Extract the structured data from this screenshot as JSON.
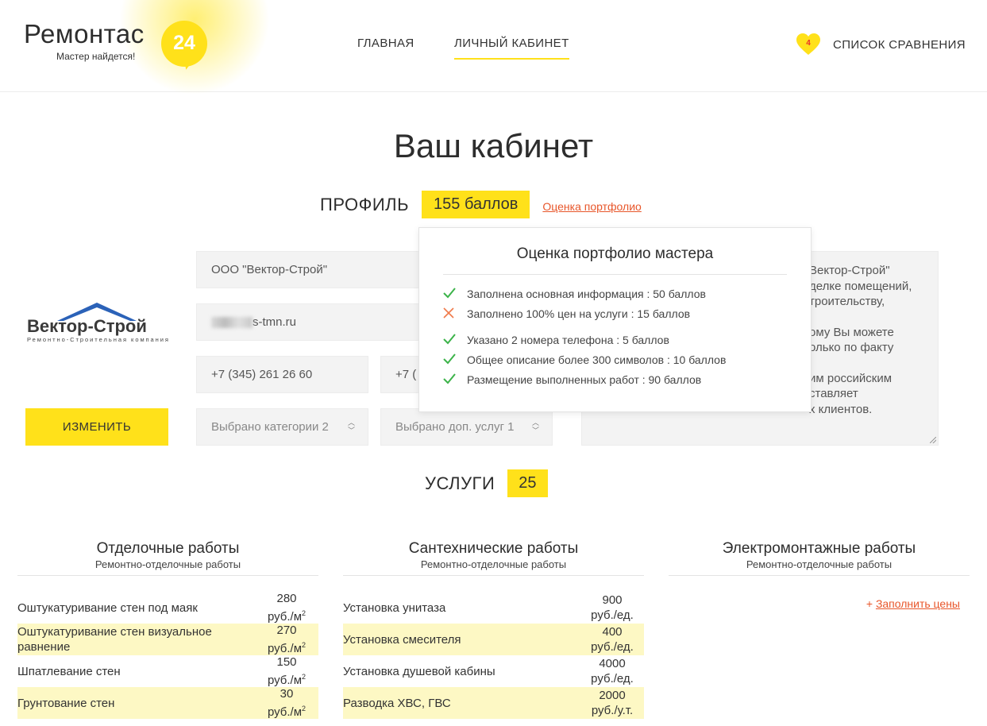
{
  "header": {
    "logo_text": "Ремонтас",
    "logo_number": "24",
    "logo_slogan": "Мастер найдется!",
    "nav": [
      {
        "label": "ГЛАВНАЯ"
      },
      {
        "label": "ЛИЧНЫЙ КАБИНЕТ",
        "active": true
      }
    ],
    "compare_count": "4",
    "compare_label": "СПИСОК СРАВНЕНИЯ"
  },
  "page_title": "Ваш кабинет",
  "profile": {
    "label": "ПРОФИЛЬ",
    "points": "155 баллов",
    "portfolio_link": "Оценка портфолио",
    "company_logo_text": "Вектор-Строй",
    "company_logo_sub": "Ремонтно-Строительная компания",
    "edit_button": "ИЗМЕНИТЬ",
    "name_value": "ООО \"Вектор-Строй\"",
    "site_value_suffix": "s-tmn.ru",
    "phone1": "+7 (345) 261 26 60",
    "phone2_visible": "+7 (",
    "categories_placeholder": "Выбрано категории 2",
    "extra_placeholder": "Выбрано доп. услуг 1",
    "description_lines": [
      "Вектор-Строй\"",
      "делке помещений,",
      "троительству,",
      "",
      "ому Вы можете",
      "олько по факту",
      "",
      "им российским",
      "ставляет",
      "х клиентов."
    ]
  },
  "popup": {
    "title": "Оценка портфолио мастера",
    "items": [
      {
        "text": "Заполнена основная информация : 50 баллов",
        "status": "ok"
      },
      {
        "text": "Заполнено 100% цен на услуги : 15 баллов",
        "status": "fail"
      },
      {
        "text": "Указано 2 номера телефона : 5 баллов",
        "status": "ok"
      },
      {
        "text": "Общее описание более 300 символов : 10 баллов",
        "status": "ok"
      },
      {
        "text": "Размещение выполненных работ : 90 баллов",
        "status": "ok"
      }
    ]
  },
  "services": {
    "label": "УСЛУГИ",
    "count": "25",
    "columns": [
      {
        "title": "Отделочные работы",
        "subtitle": "Ремонтно-отделочные работы",
        "rows": [
          {
            "name": "Оштукатуривание стен под маяк",
            "price": "280",
            "unit": "руб./м",
            "sup": "2"
          },
          {
            "name": "Оштукатуривание стен визуальное равнение",
            "price": "270",
            "unit": "руб./м",
            "sup": "2"
          },
          {
            "name": "Шпатлевание стен",
            "price": "150",
            "unit": "руб./м",
            "sup": "2"
          },
          {
            "name": "Грунтование стен",
            "price": "30",
            "unit": "руб./м",
            "sup": "2"
          }
        ]
      },
      {
        "title": "Сантехнические работы",
        "subtitle": "Ремонтно-отделочные работы",
        "rows": [
          {
            "name": "Установка унитаза",
            "price": "900",
            "unit": "руб./ед.",
            "sup": ""
          },
          {
            "name": "Установка смесителя",
            "price": "400",
            "unit": "руб./ед.",
            "sup": ""
          },
          {
            "name": "Установка душевой кабины",
            "price": "4000",
            "unit": "руб./ед.",
            "sup": ""
          },
          {
            "name": "Разводка ХВС, ГВС",
            "price": "2000",
            "unit": "руб./у.т.",
            "sup": ""
          }
        ]
      },
      {
        "title": "Электромонтажные работы",
        "subtitle": "Ремонтно-отделочные работы",
        "fill_link_plus": "+",
        "fill_link": "Заполнить цены",
        "rows": []
      }
    ]
  },
  "colors": {
    "accent_yellow": "#ffe11a",
    "link_orange": "#e8562a",
    "check_green": "#3cb34a",
    "cross_orange": "#f07a4a"
  }
}
